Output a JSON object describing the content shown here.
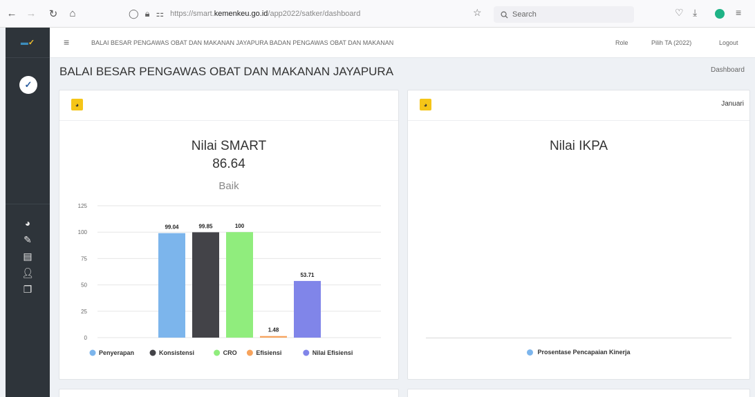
{
  "browser": {
    "url_host_prefix": "https://smart.",
    "url_host": "kemenkeu.go.id",
    "url_path": "/app2022/satker/dashboard",
    "search_placeholder": "Search"
  },
  "header": {
    "title": "BALAI BESAR PENGAWAS OBAT DAN MAKANAN JAYAPURA BADAN PENGAWAS OBAT DAN MAKANAN",
    "role": "Role",
    "ta": "Pilih TA (2022)",
    "logout": "Logout"
  },
  "page": {
    "title": "BALAI BESAR PENGAWAS OBAT DAN MAKANAN JAYAPURA",
    "breadcrumb": "Dashboard"
  },
  "smart_card": {
    "title": "Nilai SMART",
    "value": "86.64",
    "grade": "Baik"
  },
  "ikpa_card": {
    "title": "Nilai IKPA",
    "month": "Januari",
    "legend": "Prosentase Pencapaian Kinerja",
    "legend_color": "#7cb5ec"
  },
  "chart_data": {
    "type": "bar",
    "categories": [
      "Penyerapan",
      "Konsistensi",
      "CRO",
      "Efisiensi",
      "Nilai Efisiensi"
    ],
    "series": [
      {
        "name": "Penyerapan",
        "value": 99.04,
        "label": "99.04",
        "color": "#7cb5ec"
      },
      {
        "name": "Konsistensi",
        "value": 99.85,
        "label": "99.85",
        "color": "#434348"
      },
      {
        "name": "CRO",
        "value": 100,
        "label": "100",
        "color": "#90ed7d"
      },
      {
        "name": "Efisiensi",
        "value": 1.48,
        "label": "1.48",
        "color": "#f7a35c"
      },
      {
        "name": "Nilai Efisiensi",
        "value": 53.71,
        "label": "53.71",
        "color": "#8085e9"
      }
    ],
    "yticks": [
      "0",
      "25",
      "50",
      "75",
      "100",
      "125"
    ],
    "ylim": [
      0,
      125
    ],
    "grid": true,
    "legend": "bottom"
  }
}
